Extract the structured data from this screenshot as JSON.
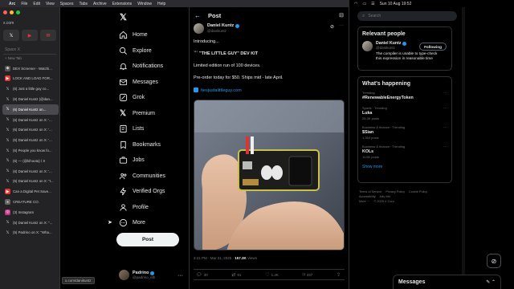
{
  "menubar": {
    "app": "Arc",
    "items": [
      "File",
      "Edit",
      "View",
      "Spaces",
      "Tabs",
      "Archive",
      "Extensions",
      "Window",
      "Help"
    ],
    "datetime": "Sun 10 Aug 19:52"
  },
  "browser": {
    "url_short": "x.com",
    "space_label": "Space X",
    "new_tab": "+ New Tab",
    "tabs": [
      {
        "title": "DEX Screener - Watchi...",
        "icon": "dex-icon",
        "color": "#555"
      },
      {
        "title": "LOCK AND LOAD FOR...",
        "icon": "youtube-icon",
        "color": "#e33"
      },
      {
        "title": "(6) Just a little guy co...",
        "icon": "x-icon",
        "color": "#222"
      },
      {
        "title": "(6) Daniel Kuntz (@dan...",
        "icon": "x-icon",
        "color": "#222"
      },
      {
        "title": "(6) Daniel Kuntz on...",
        "icon": "x-icon",
        "color": "#222"
      },
      {
        "title": "(6) Daniel Kuntz on X: '...",
        "icon": "x-icon",
        "color": "#222"
      },
      {
        "title": "(6) Daniel Kuntz on X: '...",
        "icon": "x-icon",
        "color": "#222"
      },
      {
        "title": "(6) Daniel Kuntz on X: '...",
        "icon": "x-icon",
        "color": "#222"
      },
      {
        "title": "(6) People you know fo...",
        "icon": "x-icon",
        "color": "#222"
      },
      {
        "title": "(6) — (@kihoota) / X",
        "icon": "x-icon",
        "color": "#222"
      },
      {
        "title": "(6) Daniel Kuntz on X: '...",
        "icon": "x-icon",
        "color": "#222"
      },
      {
        "title": "(6) Daniel Kuntz on X: \"I...",
        "icon": "x-icon",
        "color": "#222"
      },
      {
        "title": "Can a Digital Pet Save...",
        "icon": "youtube-icon",
        "color": "#e33"
      },
      {
        "title": "CREATURE CO.",
        "icon": "globe-icon",
        "color": "#666"
      },
      {
        "title": "(3) Instagram",
        "icon": "instagram-icon",
        "color": "#c13584"
      },
      {
        "title": "(5) Daniel Kuntz on X: \"...",
        "icon": "x-icon",
        "color": "#222"
      },
      {
        "title": "(5) Padrino on X: \"Wha...",
        "icon": "x-icon",
        "color": "#222"
      }
    ],
    "active_tab": 4,
    "status_url": "x.com/danikuntz"
  },
  "leftnav": {
    "items": [
      {
        "label": "Home",
        "icon": "home-icon"
      },
      {
        "label": "Explore",
        "icon": "search-icon"
      },
      {
        "label": "Notifications",
        "icon": "bell-icon"
      },
      {
        "label": "Messages",
        "icon": "mail-icon"
      },
      {
        "label": "Grok",
        "icon": "grok-icon"
      },
      {
        "label": "Premium",
        "icon": "x-premium-icon"
      },
      {
        "label": "Lists",
        "icon": "list-icon"
      },
      {
        "label": "Bookmarks",
        "icon": "bookmark-icon"
      },
      {
        "label": "Jobs",
        "icon": "briefcase-icon"
      },
      {
        "label": "Communities",
        "icon": "people-icon"
      },
      {
        "label": "Verified Orgs",
        "icon": "lightning-icon"
      },
      {
        "label": "Profile",
        "icon": "person-icon"
      },
      {
        "label": "More",
        "icon": "more-circle-icon"
      }
    ],
    "post_button": "Post",
    "account": {
      "name": "Padrino",
      "handle": "@padrino_eth"
    }
  },
  "post": {
    "header_title": "Post",
    "author_name": "Daniel Kuntz",
    "author_handle": "@danikuntz",
    "lines": [
      "Introducing...",
      "\"THE LITTLE GUY\" DEV KIT",
      "Limited edition run of 100 devices.",
      "Pre-order today for $50. Ships mid - late April."
    ],
    "link": "hesjustalittleguy.com",
    "timestamp": "3:41 PM · Mar 31, 2025 ·",
    "views_count": "157.3K",
    "views_label": "Views",
    "stats": {
      "replies": "30",
      "reposts": "91",
      "likes": "1.2K",
      "bookmarks": "337"
    }
  },
  "rightpanel": {
    "search_placeholder": "Search",
    "relevant_title": "Relevant people",
    "person": {
      "name": "Daniel Kuntz",
      "handle": "@danikuntz",
      "bio": "The compiler is unable to type-check this expression in reasonable time",
      "button": "Following"
    },
    "happening_title": "What's happening",
    "trends": [
      {
        "context": "Trending",
        "name": "#RenewableEnergyToken",
        "posts": ""
      },
      {
        "context": "Sports · Trending",
        "name": "Luka",
        "posts": "25.3K posts"
      },
      {
        "context": "Business & finance · Trending",
        "name": "$Sian",
        "posts": "1,394 posts"
      },
      {
        "context": "Business & finance · Trending",
        "name": "KOLs",
        "posts": "11.6K posts"
      }
    ],
    "show_more": "Show more",
    "footer_line1": [
      "Terms of Service",
      "Privacy Policy",
      "Cookie Policy"
    ],
    "footer_line2": [
      "Accessibility",
      "Ads info"
    ],
    "footer_line3": [
      "More ···",
      "© 2025 X Corp."
    ],
    "messages_label": "Messages"
  }
}
